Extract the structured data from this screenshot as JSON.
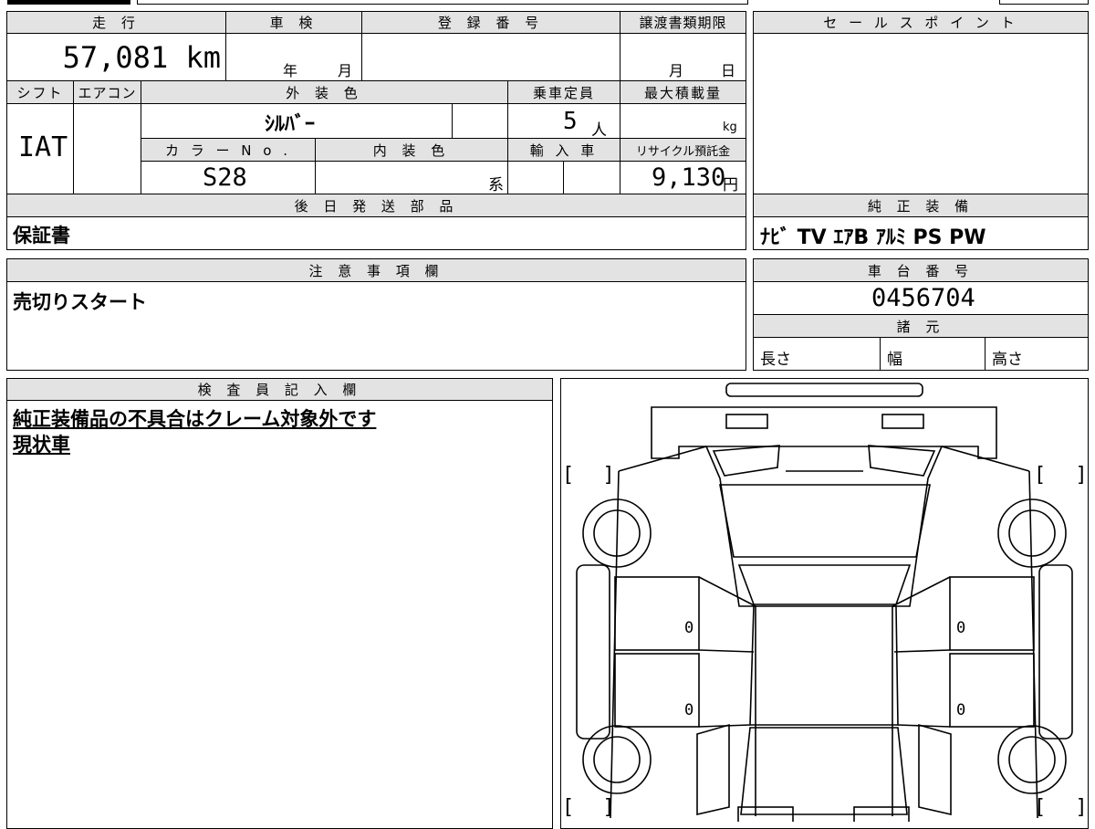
{
  "headers": {
    "mileage": "走 行",
    "inspection": "車 検",
    "registration_no": "登 録 番 号",
    "transfer_deadline": "譲渡書類期限",
    "sales_point": "セ ー ル ス ポ イ ン ト",
    "shift": "シフト",
    "aircon": "エアコン",
    "exterior_color": "外 装 色",
    "capacity": "乗車定員",
    "max_load": "最大積載量",
    "color_no": "カ ラ ー N o .",
    "interior_color": "内 装 色",
    "import_car": "輸 入 車",
    "recycle_fee": "リサイクル預託金",
    "later_parts": "後 日 発 送 部 品",
    "genuine_equipment": "純 正 装 備",
    "notes": "注 意 事 項 欄",
    "chassis_no": "車 台 番 号",
    "specs": "諸 元",
    "inspector": "検 査 員 記 入 欄"
  },
  "values": {
    "mileage": "57,081 km",
    "year_unit": "年",
    "month_unit": "月",
    "deadline_month": "月",
    "deadline_day": "日",
    "shift": "IAT",
    "exterior_color": "ｼﾙﾊﾞｰ",
    "capacity": "5",
    "capacity_unit": "人",
    "load_unit": "kg",
    "color_no": "S28",
    "interior_suffix": "系",
    "recycle_fee": "9,130",
    "recycle_unit": "円",
    "later_parts": "保証書",
    "genuine_equipment": "ﾅﾋﾞ TV ｴｱB ｱﾙﾐ PS PW",
    "notes": "売切りスタート",
    "chassis_no": "0456704",
    "length_label": "長さ",
    "width_label": "幅",
    "height_label": "高さ"
  },
  "inspector_lines": [
    "純正装備品の不具合はクレーム対象外です",
    "現状車"
  ],
  "diagram": {
    "panel_marks": [
      "0",
      "0",
      "0",
      "0"
    ],
    "bracket_left": "[",
    "bracket_right": "]"
  }
}
